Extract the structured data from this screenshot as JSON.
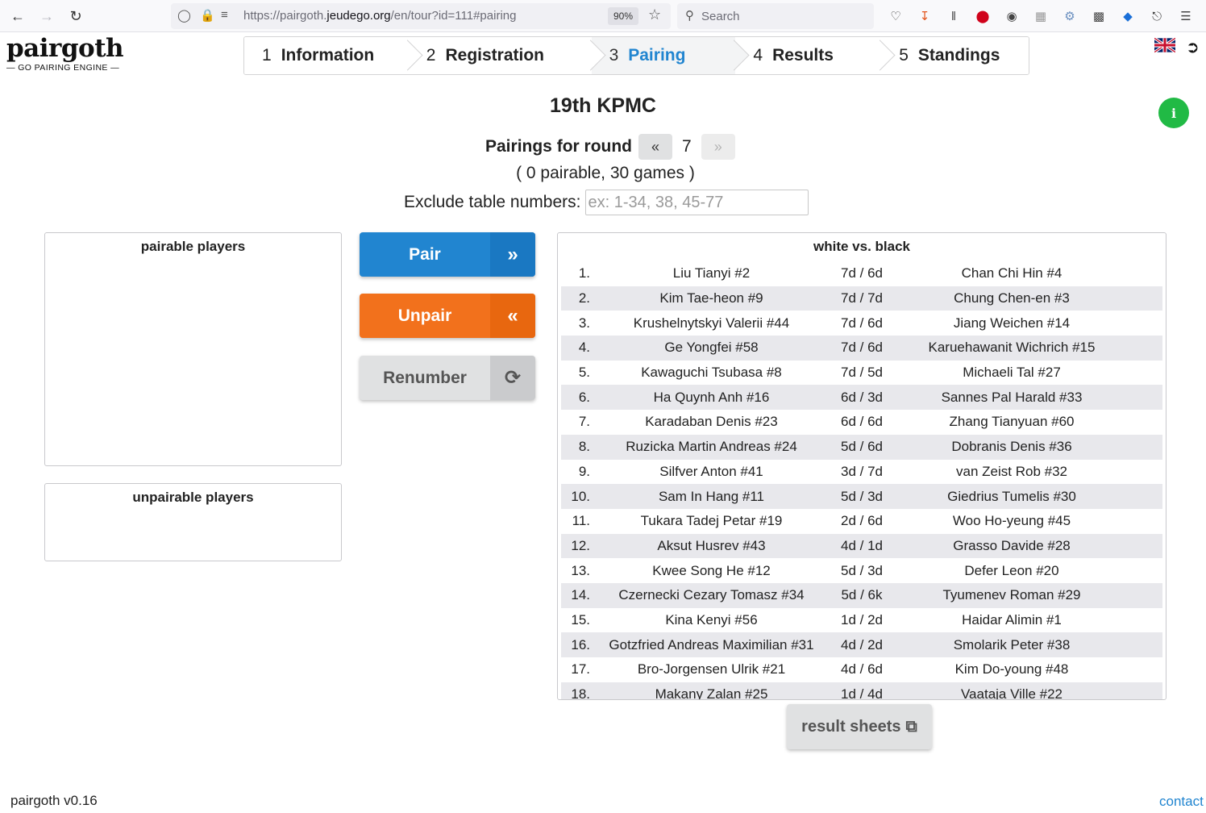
{
  "browser": {
    "url_prefix": "https://pairgoth.",
    "url_domain": "jeudego.org",
    "url_suffix": "/en/tour?id=111#pairing",
    "zoom": "90%",
    "search_placeholder": "Search"
  },
  "app": {
    "logo_word": "pairgoth",
    "logo_sub": "— GO PAIRING ENGINE —"
  },
  "steps": [
    {
      "num": "1",
      "label": "Information"
    },
    {
      "num": "2",
      "label": "Registration"
    },
    {
      "num": "3",
      "label": "Pairing"
    },
    {
      "num": "4",
      "label": "Results"
    },
    {
      "num": "5",
      "label": "Standings"
    }
  ],
  "info_icon": "i",
  "tournament": {
    "title": "19th KPMC",
    "round_label": "Pairings for round",
    "prev": "«",
    "round": "7",
    "next": "»",
    "counts": "( 0 pairable, 30 games )",
    "exclude_label": "Exclude table numbers:",
    "exclude_placeholder": "ex: 1-34, 38, 45-77"
  },
  "panels": {
    "pairable_title": "pairable players",
    "unpairable_title": "unpairable players",
    "games_title": "white vs. black"
  },
  "actions": {
    "pair": "Pair",
    "unpair": "Unpair",
    "renumber": "Renumber"
  },
  "games": [
    {
      "n": "1.",
      "white": "Liu Tianyi #2",
      "levels": "7d / 6d",
      "black": "Chan Chi Hin #4"
    },
    {
      "n": "2.",
      "white": "Kim Tae-heon #9",
      "levels": "7d / 7d",
      "black": "Chung Chen-en #3"
    },
    {
      "n": "3.",
      "white": "Krushelnytskyi Valerii #44",
      "levels": "7d / 6d",
      "black": "Jiang Weichen #14"
    },
    {
      "n": "4.",
      "white": "Ge Yongfei #58",
      "levels": "7d / 6d",
      "black": "Karuehawanit Wichrich #15"
    },
    {
      "n": "5.",
      "white": "Kawaguchi Tsubasa #8",
      "levels": "7d / 5d",
      "black": "Michaeli Tal #27"
    },
    {
      "n": "6.",
      "white": "Ha Quynh Anh #16",
      "levels": "6d / 3d",
      "black": "Sannes Pal Harald #33"
    },
    {
      "n": "7.",
      "white": "Karadaban Denis #23",
      "levels": "6d / 6d",
      "black": "Zhang Tianyuan #60"
    },
    {
      "n": "8.",
      "white": "Ruzicka Martin Andreas #24",
      "levels": "5d / 6d",
      "black": "Dobranis Denis #36"
    },
    {
      "n": "9.",
      "white": "Silfver Anton #41",
      "levels": "3d / 7d",
      "black": "van Zeist Rob #32"
    },
    {
      "n": "10.",
      "white": "Sam In Hang #11",
      "levels": "5d / 3d",
      "black": "Giedrius Tumelis #30"
    },
    {
      "n": "11.",
      "white": "Tukara Tadej Petar #19",
      "levels": "2d / 6d",
      "black": "Woo Ho-yeung #45"
    },
    {
      "n": "12.",
      "white": "Aksut Husrev #43",
      "levels": "4d / 1d",
      "black": "Grasso Davide #28"
    },
    {
      "n": "13.",
      "white": "Kwee Song He #12",
      "levels": "5d / 3d",
      "black": "Defer Leon #20"
    },
    {
      "n": "14.",
      "white": "Czernecki Cezary Tomasz #34",
      "levels": "5d / 6k",
      "black": "Tyumenev Roman #29"
    },
    {
      "n": "15.",
      "white": "Kina Kenyi #56",
      "levels": "1d / 2d",
      "black": "Haidar Alimin #1"
    },
    {
      "n": "16.",
      "white": "Gotzfried Andreas Maximilian #31",
      "levels": "4d / 2d",
      "black": "Smolarik Peter #38"
    },
    {
      "n": "17.",
      "white": "Bro-Jorgensen Ulrik #21",
      "levels": "4d / 6d",
      "black": "Kim Do-young #48"
    },
    {
      "n": "18.",
      "white": "Makany Zalan #25",
      "levels": "1d / 4d",
      "black": "Vaataja Ville #22"
    }
  ],
  "result_sheets": "result sheets",
  "footer": {
    "version": "pairgoth v0.16",
    "contact": "contact"
  },
  "colors": {
    "primary": "#2185d0",
    "orange": "#f2711c",
    "green": "#21ba45",
    "grey": "#e0e1e2"
  }
}
